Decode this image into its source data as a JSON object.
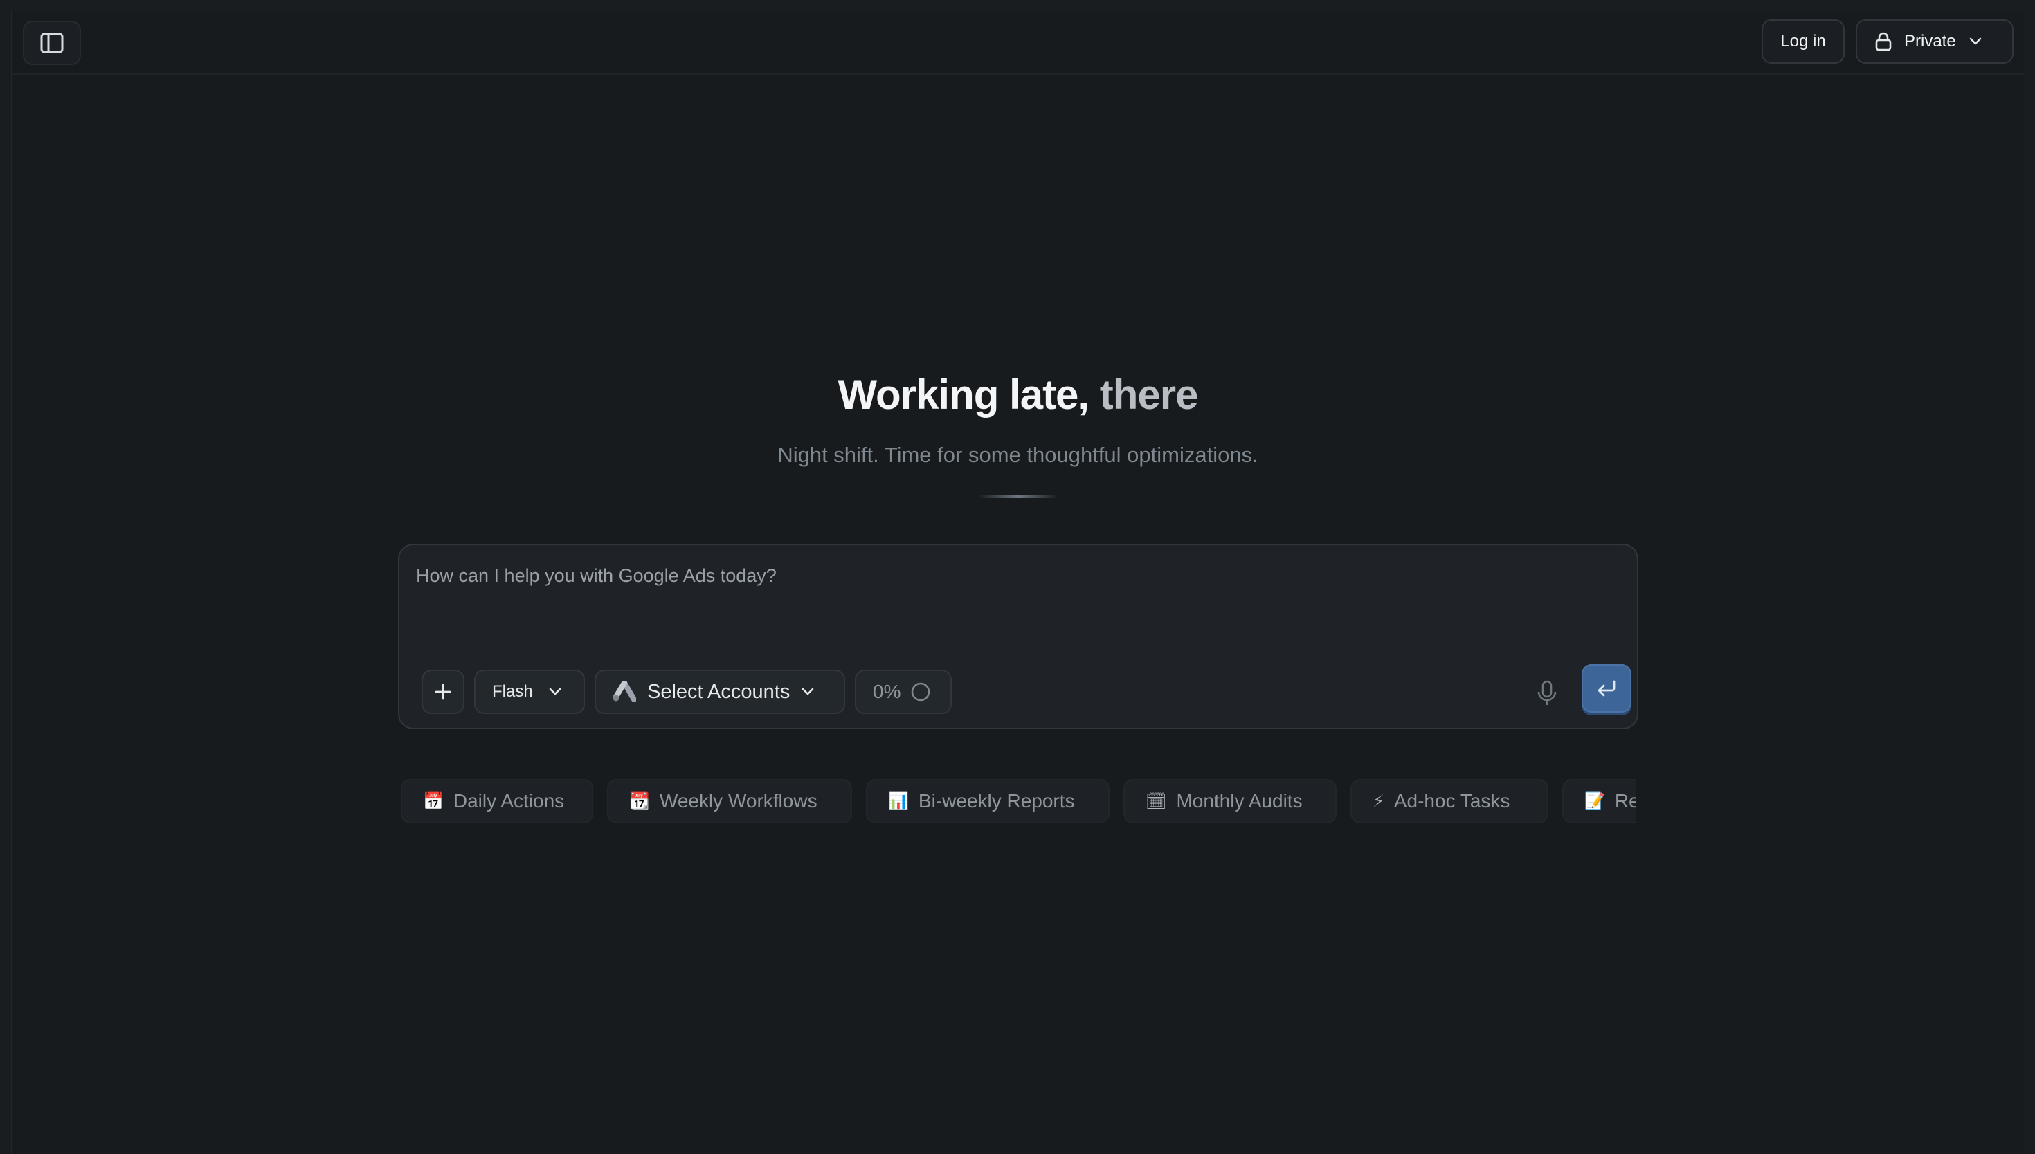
{
  "header": {
    "login_label": "Log in",
    "privacy_label": "Private"
  },
  "hero": {
    "title_part1": "Working late,",
    "title_part2": "there",
    "subtitle": "Night shift. Time for some thoughtful optimizations."
  },
  "composer": {
    "placeholder": "How can I help you with Google Ads today?",
    "value": "",
    "model_label": "Flash",
    "accounts_label": "Select Accounts",
    "usage_percent": "0%"
  },
  "icons": {
    "sidebar": "sidebar-toggle-icon",
    "lock": "lock-icon",
    "chevron": "chevron-down-icon",
    "plus": "plus-icon",
    "google_ads": "google-ads-logo-icon",
    "progress": "progress-ring-icon",
    "mic": "microphone-icon",
    "send": "enter-return-icon"
  },
  "colors": {
    "background": "#171b1e",
    "send_button": "#3e6598",
    "muted_text": "#7f878f"
  },
  "chips": [
    {
      "icon": "📅",
      "label": "Daily Actions"
    },
    {
      "icon": "📆",
      "label": "Weekly Workflows"
    },
    {
      "icon": "📊",
      "label": "Bi-weekly Reports"
    },
    {
      "icon": "🗓",
      "label": "Monthly Audits"
    },
    {
      "icon": "⚡",
      "label": "Ad-hoc Tasks"
    },
    {
      "icon": "📝",
      "label": "Re"
    }
  ]
}
